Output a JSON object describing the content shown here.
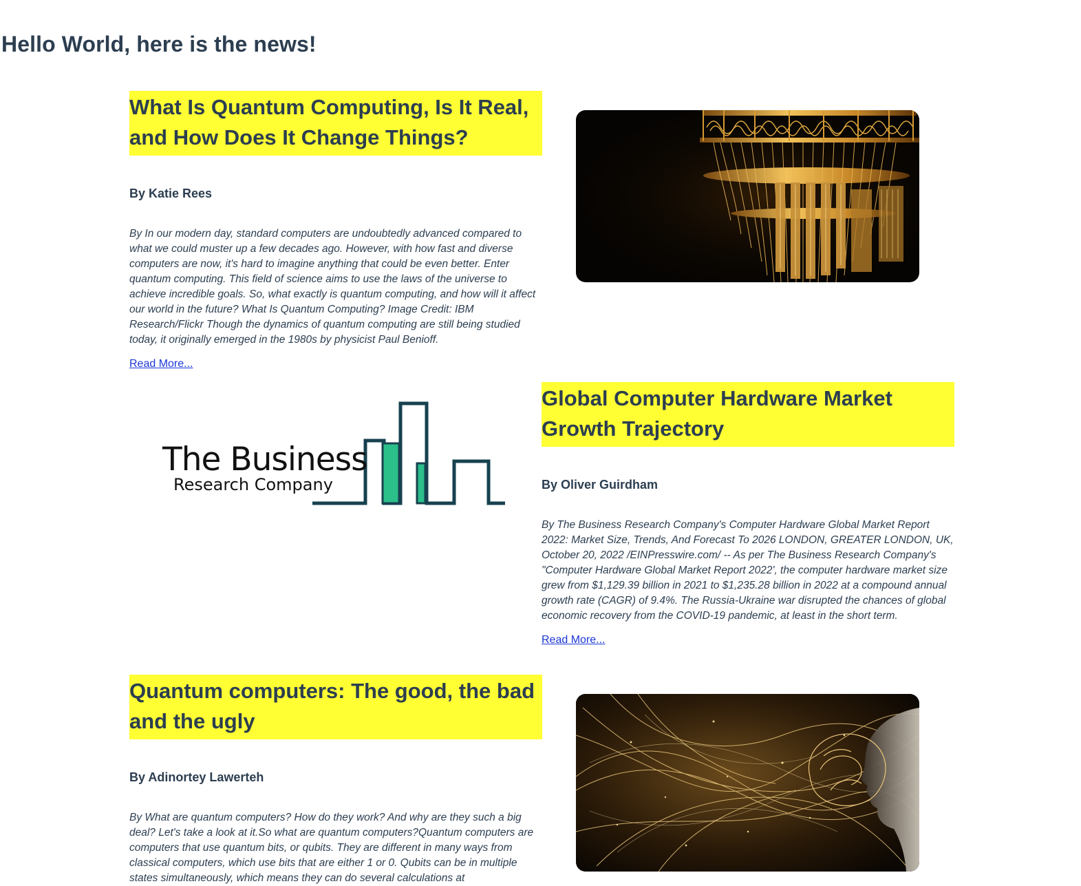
{
  "page": {
    "title": "Hello World, here is the news!"
  },
  "articles": [
    {
      "title": "What Is Quantum Computing, Is It Real, and How Does It Change Things?",
      "author": "By Katie Rees",
      "summary": "By In our modern day, standard computers are undoubtedly advanced compared to what we could muster up a few decades ago. However, with how fast and diverse computers are now, it's hard to imagine anything that could be even better. Enter quantum computing. This field of science aims to use the laws of the universe to achieve incredible goals. So, what exactly is quantum computing, and how will it affect our world in the future? What Is Quantum Computing? Image Credit: IBM Research/Flickr Though the dynamics of quantum computing are still being studied today, it originally emerged in the 1980s by physicist Paul Benioff.",
      "read_more": "Read More...",
      "image_icon": "quantum-computer-chandelier-image"
    },
    {
      "title": "Global Computer Hardware Market Growth Trajectory",
      "author": "By Oliver Guirdham",
      "summary": "By The Business Research Company's Computer Hardware Global Market Report 2022: Market Size, Trends, And Forecast To 2026 LONDON, GREATER LONDON, UK, October 20, 2022 /EINPresswire.com/ -- As per The Business Research Company's \"Computer Hardware Global Market Report 2022', the computer hardware market size grew from $1,129.39 billion in 2021 to $1,235.28 billion in 2022 at a compound annual growth rate (CAGR) of 9.4%. The Russia-Ukraine war disrupted the chances of global economic recovery from the COVID-19 pandemic, at least in the short term.",
      "read_more": "Read More...",
      "logo_line1": "The Business",
      "logo_line2": "Research Company",
      "image_icon": "business-research-company-logo"
    },
    {
      "title": "Quantum computers: The good, the bad and the ugly",
      "author": "By Adinortey Lawerteh",
      "summary": "By What are quantum computers? How do they work? And why are they such a big deal? Let's take a look at it.So what are quantum computers?Quantum computers are computers that use quantum bits, or qubits. They are different in many ways from classical computers, which use bits that are either 1 or 0. Qubits can be in multiple states simultaneously, which means they can do several calculations at",
      "image_icon": "golden-ai-face-image"
    }
  ],
  "colors": {
    "headline_highlight": "#ffff33",
    "text": "#2c3e50",
    "link": "#1a36d6",
    "logo_dark": "#17414f",
    "logo_green": "#2bbf8a"
  }
}
